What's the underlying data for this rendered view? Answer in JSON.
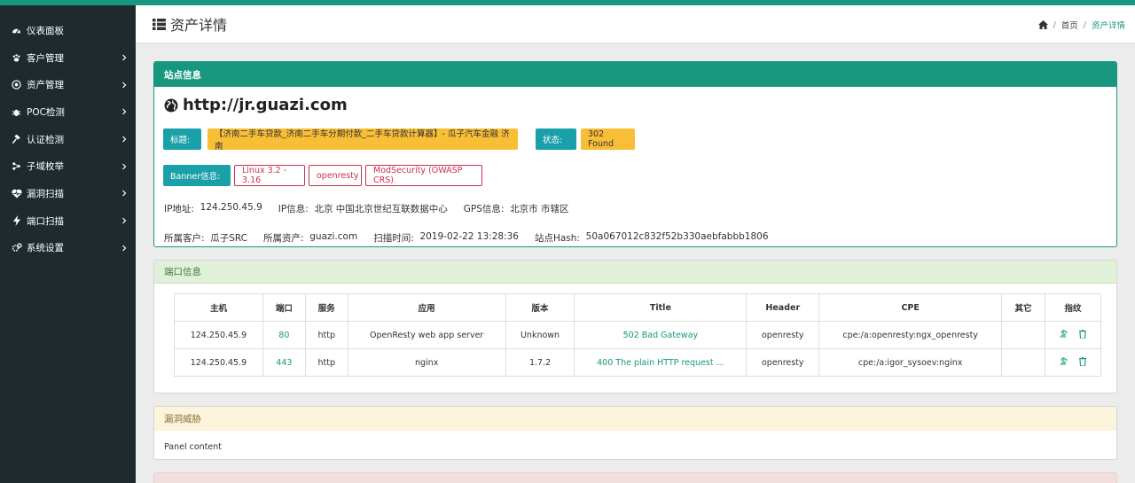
{
  "sidebar": {
    "items": [
      {
        "label": "仪表面板",
        "icon": "dashboard-icon",
        "chevron": false
      },
      {
        "label": "客户管理",
        "icon": "paw-icon",
        "chevron": true
      },
      {
        "label": "资产管理",
        "icon": "target-icon",
        "chevron": true
      },
      {
        "label": "POC检测",
        "icon": "bug-icon",
        "chevron": true
      },
      {
        "label": "认证检测",
        "icon": "gavel-icon",
        "chevron": true
      },
      {
        "label": "子域枚举",
        "icon": "sitemap-icon",
        "chevron": true
      },
      {
        "label": "漏洞扫描",
        "icon": "heartbeat-icon",
        "chevron": true
      },
      {
        "label": "端口扫描",
        "icon": "bolt-icon",
        "chevron": true
      },
      {
        "label": "系统设置",
        "icon": "cogs-icon",
        "chevron": true
      }
    ]
  },
  "header": {
    "title": "资产详情"
  },
  "breadcrumb": {
    "home": "首页",
    "current": "资产详情"
  },
  "site_panel": {
    "heading": "站点信息",
    "url": "http://jr.guazi.com",
    "title_label": "标题:",
    "title_value": "【济南二手车贷款_济南二手车分期付款_二手车贷款计算器】- 瓜子汽车金融 济南",
    "status_label": "状态:",
    "status_value": "302 Found",
    "banner_label": "Banner信息:",
    "banners": [
      "Linux 3.2 - 3.16",
      "openresty",
      "ModSecurity (OWASP CRS)"
    ],
    "ip_label": "IP地址:",
    "ip_value": "124.250.45.9",
    "ipinfo_label": "IP信息:",
    "ipinfo_value": "北京 中国北京世纪互联数据中心",
    "gps_label": "GPS信息:",
    "gps_value": "北京市 市辖区",
    "customer_label": "所属客户:",
    "customer_value": "瓜子SRC",
    "asset_label": "所属资产:",
    "asset_value": "guazi.com",
    "scan_label": "扫描时间:",
    "scan_value": "2019-02-22 13:28:36",
    "hash_label": "站点Hash:",
    "hash_value": "50a067012c832f52b330aebfabbb1806"
  },
  "port_panel": {
    "heading": "端口信息",
    "columns": [
      "主机",
      "端口",
      "服务",
      "应用",
      "版本",
      "Title",
      "Header",
      "CPE",
      "其它",
      "指纹"
    ],
    "rows": [
      {
        "host": "124.250.45.9",
        "port": "80",
        "service": "http",
        "app": "OpenResty web app server",
        "version": "Unknown",
        "title": "502 Bad Gateway",
        "header": "openresty",
        "cpe": "cpe:/a:openresty:ngx_openresty",
        "other": ""
      },
      {
        "host": "124.250.45.9",
        "port": "443",
        "service": "http",
        "app": "nginx",
        "version": "1.7.2",
        "title": "400 The plain HTTP request ...",
        "header": "openresty",
        "cpe": "cpe:/a:igor_sysoev:nginx",
        "other": ""
      }
    ]
  },
  "vuln_panel": {
    "heading": "漏洞威胁",
    "body": "Panel content"
  },
  "colors": {
    "accent": "#17977f",
    "sidebar": "#1e2a2e",
    "warning": "#f8be36",
    "danger": "#c9304f",
    "info": "#1aa0a8"
  }
}
